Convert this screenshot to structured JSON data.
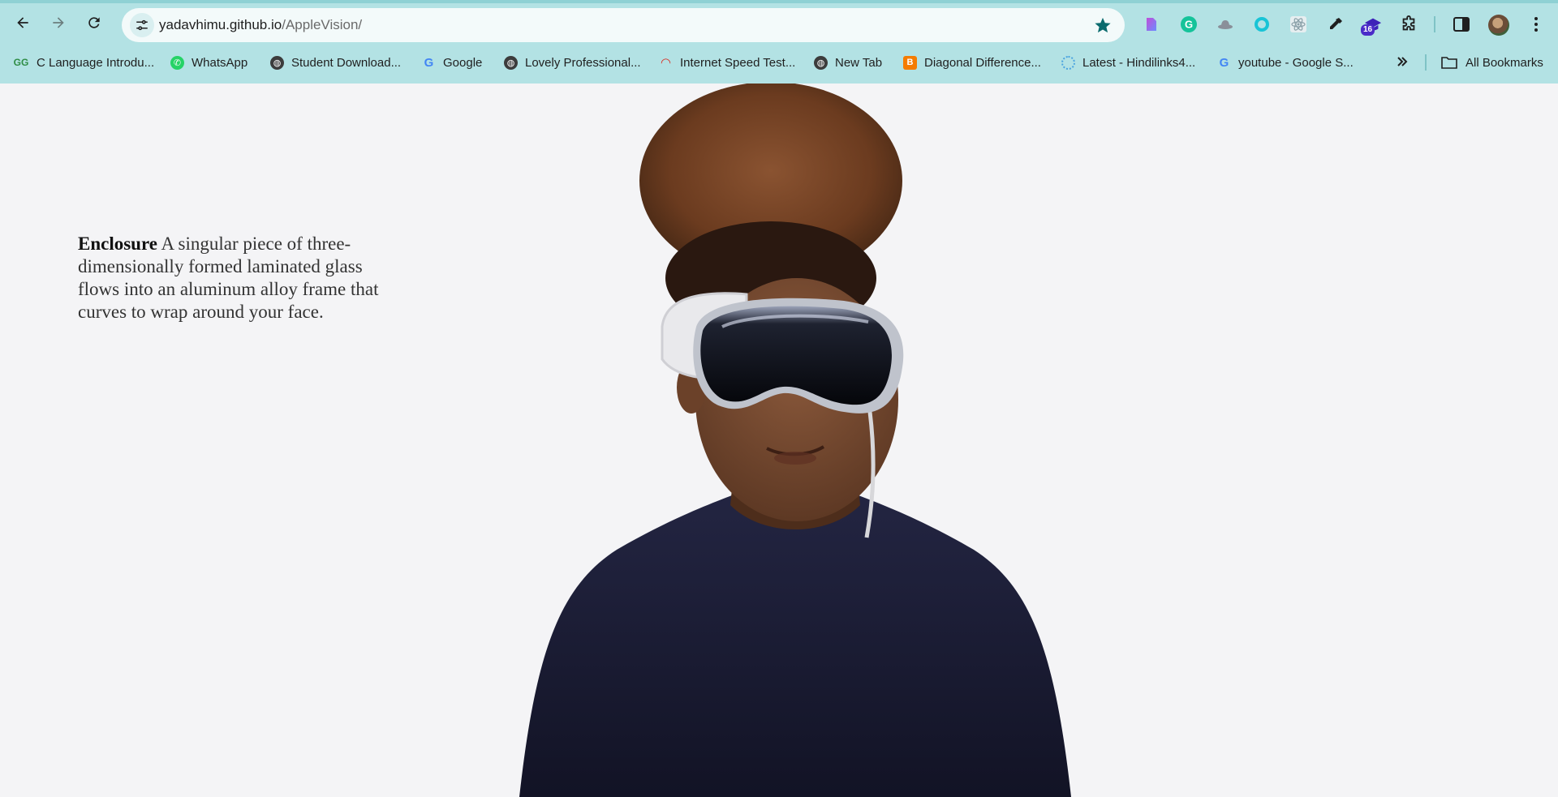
{
  "browser": {
    "url_host": "yadavhimu.github.io",
    "url_path": "/AppleVision/",
    "extension_badge": "16",
    "bookmarks": [
      {
        "label": "C Language Introdu...",
        "icon": "geeksforgeeks-icon",
        "color": "#2f8d46"
      },
      {
        "label": "WhatsApp",
        "icon": "whatsapp-icon",
        "color": "#25d366"
      },
      {
        "label": "Student Download...",
        "icon": "globe-icon",
        "color": "#3c3c3c"
      },
      {
        "label": "Google",
        "icon": "google-icon",
        "color": "#4285f4"
      },
      {
        "label": "Lovely Professional...",
        "icon": "globe-icon",
        "color": "#3c3c3c"
      },
      {
        "label": "Internet Speed Test...",
        "icon": "speedometer-icon",
        "color": "#d93025"
      },
      {
        "label": "New Tab",
        "icon": "globe-icon",
        "color": "#3c3c3c"
      },
      {
        "label": "Diagonal Difference...",
        "icon": "blogger-icon",
        "color": "#f57c00"
      },
      {
        "label": "Latest - Hindilinks4...",
        "icon": "loading-ring-icon",
        "color": "#4aa3df"
      },
      {
        "label": "youtube - Google S...",
        "icon": "google-icon",
        "color": "#4285f4"
      }
    ],
    "all_bookmarks_label": "All Bookmarks"
  },
  "content": {
    "feature_title": "Enclosure",
    "feature_body": "A singular piece of three-dimensionally formed laminated glass flows into an aluminum alloy frame that curves to wrap around your face."
  },
  "colors": {
    "chrome_bg": "#b3e2e4",
    "omnibox_bg": "#f3fafa",
    "page_bg": "#f4f4f6",
    "star": "#0b6b6e"
  }
}
